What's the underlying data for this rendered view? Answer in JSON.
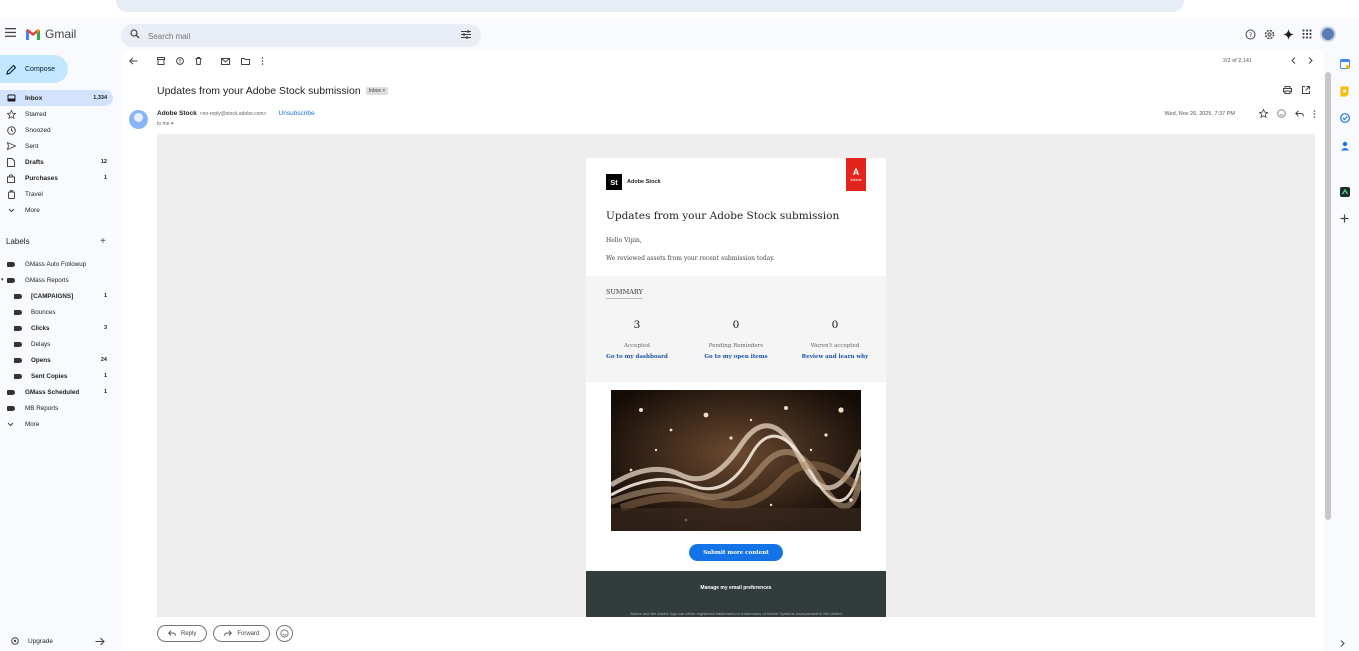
{
  "app": {
    "name": "Gmail"
  },
  "search": {
    "placeholder": "Search mail"
  },
  "compose": {
    "label": "Compose"
  },
  "nav": [
    {
      "label": "Inbox",
      "count": "1,334",
      "icon": "inbox-icon"
    },
    {
      "label": "Starred",
      "count": "",
      "icon": "star-icon"
    },
    {
      "label": "Snoozed",
      "count": "",
      "icon": "clock-icon"
    },
    {
      "label": "Sent",
      "count": "",
      "icon": "send-icon"
    },
    {
      "label": "Drafts",
      "count": "12",
      "icon": "draft-icon"
    },
    {
      "label": "Purchases",
      "count": "1",
      "icon": "bag-icon"
    },
    {
      "label": "Travel",
      "count": "",
      "icon": "luggage-icon"
    },
    {
      "label": "More",
      "count": "",
      "icon": "chevron-down-icon"
    }
  ],
  "labels": {
    "title": "Labels",
    "items": [
      {
        "label": "GMass Auto Followup",
        "count": ""
      },
      {
        "label": "GMass Reports",
        "count": ""
      },
      {
        "label": "[CAMPAIGNS]",
        "count": "1"
      },
      {
        "label": "Bounces",
        "count": ""
      },
      {
        "label": "Clicks",
        "count": "3"
      },
      {
        "label": "Delays",
        "count": ""
      },
      {
        "label": "Opens",
        "count": "24"
      },
      {
        "label": "Sent Copies",
        "count": "1"
      },
      {
        "label": "GMass Scheduled",
        "count": "1"
      },
      {
        "label": "MB Reports",
        "count": ""
      },
      {
        "label": "More",
        "count": ""
      }
    ]
  },
  "upgrade": {
    "label": "Upgrade"
  },
  "toolbar": {
    "pager": "2/2 of 2,141"
  },
  "message": {
    "subject": "Updates from your Adobe Stock submission",
    "tag": "Inbox",
    "sender_name": "Adobe Stock",
    "sender_email": "<no-reply@stock.adobe.com>",
    "unsubscribe": "Unsubscribe",
    "to": "to me",
    "date": "Wed, Nov 26, 2025, 7:37 PM"
  },
  "email": {
    "brand": "Adobe Stock",
    "brand_logo": "St",
    "adobe_flag": "Adobe",
    "title": "Updates from your Adobe Stock submission",
    "greeting": "Hello Vipin,",
    "intro": "We reviewed assets from your recent submission today.",
    "summary_title": "SUMMARY",
    "stats": [
      {
        "num": "3",
        "label": "Accepted",
        "link": "Go to my dashboard"
      },
      {
        "num": "0",
        "label": "Pending Reminders",
        "link": "Go to my open items"
      },
      {
        "num": "0",
        "label": "Weren't accepted",
        "link": "Review and learn why"
      }
    ],
    "cta": "Submit more content",
    "footer_pref": "Manage my email preferences",
    "footer_legal": "Adobe and the Adobe logo are either registered trademarks or trademarks of Adobe Systems Incorporated in the United"
  },
  "reply": {
    "reply": "Reply",
    "forward": "Forward"
  },
  "colors": {
    "accent": "#c2e7ff",
    "link": "#1a73e8",
    "adobe_red": "#e1251b",
    "cta_blue": "#1473e6"
  }
}
